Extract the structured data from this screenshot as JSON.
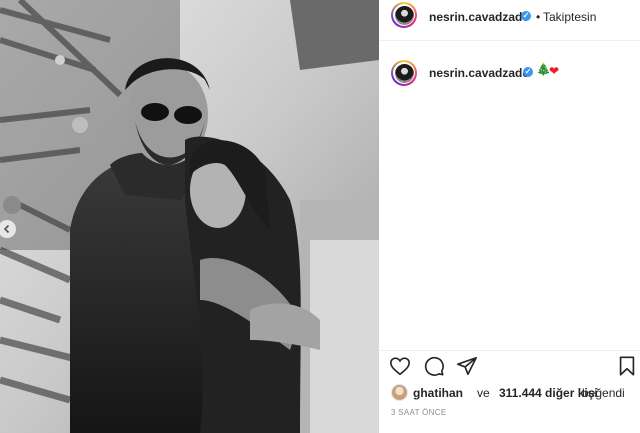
{
  "post": {
    "author": "nesrin.cavadzade",
    "follow_status": "Takiptesin",
    "separator": "•",
    "verified_mark": "✓",
    "caption_emoji_1": "🎄",
    "caption_emoji_2": "❤",
    "photo": {
      "style": "black-and-white",
      "subject": "couple-hugging"
    }
  },
  "likes": {
    "first_liker": "ghatihan",
    "connector": "ve",
    "others": "311.444 diğer kişi",
    "suffix": "beğendi"
  },
  "timestamp": "3 SAAT ÖNCE",
  "icons": [
    "heart-icon",
    "comment-icon",
    "share-icon",
    "bookmark-icon",
    "chevron-left-icon",
    "verified-badge-icon"
  ],
  "colors": {
    "verified": "#3897f0",
    "text": "#262626",
    "muted": "#8e8e8e",
    "divider": "#efefef"
  }
}
